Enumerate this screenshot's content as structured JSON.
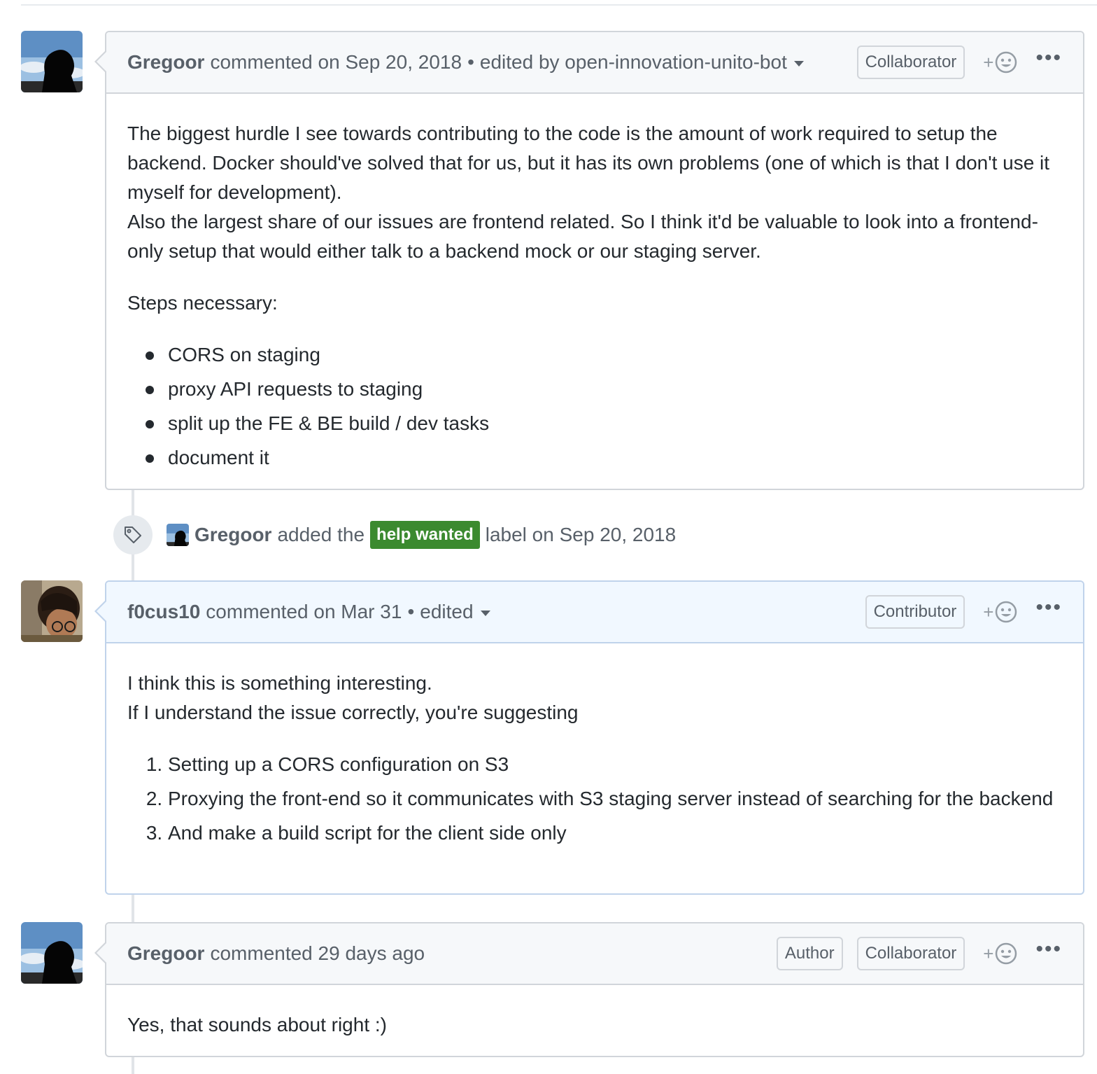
{
  "comments": [
    {
      "author": "Gregoor",
      "action": "commented on Sep 20, 2018",
      "separator": "•",
      "edited": "edited by open-innovation-unito-bot",
      "badges": [
        "Collaborator"
      ],
      "paragraphs": [
        "The biggest hurdle I see towards contributing to the code is the amount of work required to setup the backend. Docker should've solved that for us, but it has its own problems (one of which is that I don't use it myself for development).\nAlso the largest share of our issues are frontend related. So I think it'd be valuable to look into a frontend-only setup that would either talk to a backend mock or our staging server.",
        "Steps necessary:"
      ],
      "list": [
        "CORS on staging",
        "proxy API requests to staging",
        "split up the FE & BE build / dev tasks",
        "document it"
      ]
    },
    {
      "author": "f0cus10",
      "action": "commented on Mar 31",
      "separator": "•",
      "edited": "edited",
      "badges": [
        "Contributor"
      ],
      "paragraphs": [
        "I think this is something interesting.\nIf I understand the issue correctly, you're suggesting"
      ],
      "list": [
        "Setting up a CORS configuration on S3",
        "Proxying the front-end so it communicates with S3 staging server instead of searching for the backend",
        "And make a build script for the client side only"
      ]
    },
    {
      "author": "Gregoor",
      "action": "commented 29 days ago",
      "badges": [
        "Author",
        "Collaborator"
      ],
      "paragraphs": [
        "Yes, that sounds about right :)"
      ]
    }
  ],
  "event": {
    "icon": "tag-icon",
    "actor": "Gregoor",
    "text_before": "added the",
    "label": "help wanted",
    "label_color": "#3b8a2f",
    "text_after": "label on Sep 20, 2018"
  },
  "reaction": {
    "plus": "+",
    "icon": "smiley-icon"
  },
  "more_icon": "•••",
  "colors": {
    "border": "#d1d5da",
    "header_bg": "#f6f8fa",
    "current_header_bg": "#f1f8ff",
    "current_border": "#c0d3eb",
    "text": "#24292e",
    "muted": "#586069"
  }
}
